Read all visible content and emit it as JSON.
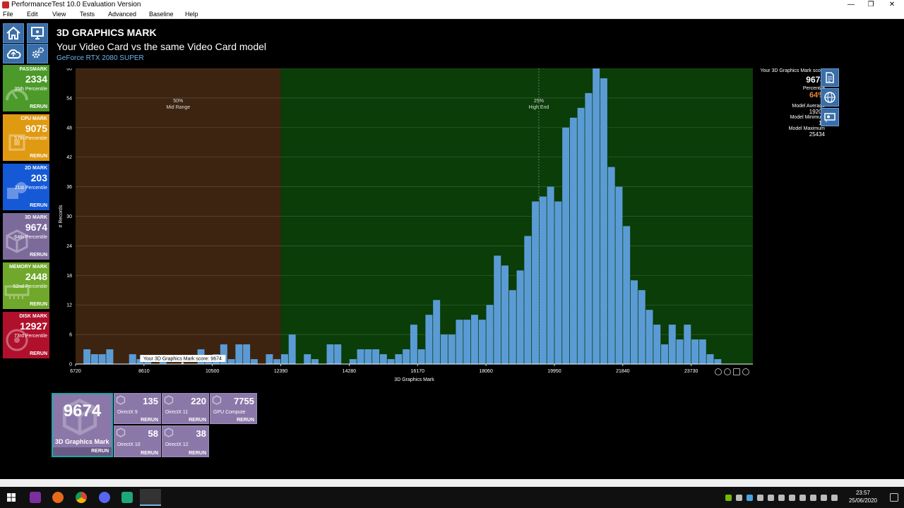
{
  "window": {
    "title": "PerformanceTest 10.0 Evaluation Version"
  },
  "menu": [
    "File",
    "Edit",
    "View",
    "Tests",
    "Advanced",
    "Baseline",
    "Help"
  ],
  "tiles": [
    {
      "name": "PASSMARK",
      "value": "2334",
      "percentile": "35th Percentile",
      "rerun": "RERUN",
      "color": "#4c9a2a"
    },
    {
      "name": "CPU MARK",
      "value": "9075",
      "percentile": "57th Percentile",
      "rerun": "RERUN",
      "color": "#e09a12"
    },
    {
      "name": "2D MARK",
      "value": "203",
      "percentile": "21st Percentile",
      "rerun": "RERUN",
      "color": "#1559d6"
    },
    {
      "name": "3D MARK",
      "value": "9674",
      "percentile": "64th Percentile",
      "rerun": "RERUN",
      "color": "#7c6a9a"
    },
    {
      "name": "MEMORY MARK",
      "value": "2448",
      "percentile": "52nd Percentile",
      "rerun": "RERUN",
      "color": "#6fa82a"
    },
    {
      "name": "DISK MARK",
      "value": "12927",
      "percentile": "73rd Percentile",
      "rerun": "RERUN",
      "color": "#b0102c"
    }
  ],
  "heading": "3D GRAPHICS MARK",
  "subheading": "Your Video Card vs the same Video Card model",
  "gpu_name": "GeForce RTX 2080 SUPER",
  "score_panel": {
    "label": "Your 3D Graphics Mark score",
    "score": "9674",
    "percentile_label": "Percentile",
    "percentile": "64%",
    "avg_label": "Model Average",
    "avg": "19206",
    "min_label": "Model Minimum",
    "min": "10",
    "max_label": "Model Maximum",
    "max": "25434"
  },
  "chart_data": {
    "type": "bar",
    "xlabel": "3D Graphics Mark",
    "ylabel": "# Records",
    "xlim": [
      6720,
      25434
    ],
    "ylim": [
      0,
      60
    ],
    "x_ticks": [
      6720,
      8610,
      10500,
      12390,
      14280,
      16170,
      18060,
      19950,
      21840,
      23730
    ],
    "y_ticks": [
      0,
      6,
      12,
      18,
      24,
      30,
      36,
      42,
      48,
      54,
      60
    ],
    "grid": true,
    "regions": [
      {
        "pct": "50%",
        "label": "Mid Range",
        "from": 6720,
        "to": 12390,
        "color": "#3d2410"
      },
      {
        "pct": "25%",
        "label": "High End",
        "from": 12390,
        "to": 25434,
        "color": "#0a3d08"
      }
    ],
    "bin_start": 6720,
    "bin_width": 210,
    "values": [
      0,
      3,
      2,
      2,
      3,
      0,
      0,
      2,
      1,
      1,
      0,
      1,
      0,
      0,
      0,
      0,
      3,
      1,
      2,
      4,
      1,
      4,
      4,
      1,
      0,
      2,
      1,
      2,
      6,
      0,
      2,
      1,
      0,
      4,
      4,
      0,
      1,
      3,
      3,
      3,
      2,
      1,
      2,
      3,
      8,
      3,
      10,
      13,
      6,
      6,
      9,
      9,
      10,
      9,
      12,
      22,
      20,
      15,
      19,
      26,
      33,
      34,
      36,
      33,
      48,
      50,
      52,
      55,
      60,
      58,
      40,
      36,
      28,
      17,
      15,
      11,
      8,
      4,
      8,
      5,
      8,
      5,
      5,
      2,
      1
    ],
    "bar_color": "#5b9bd5",
    "marker_label": "Your 3D Graphics Mark score: 9674",
    "marker_value": 9674,
    "median_value": 19520
  },
  "sub_tiles": {
    "main": {
      "value": "9674",
      "name": "3D Graphics Mark",
      "rerun": "RERUN"
    },
    "dx9": {
      "value": "135",
      "name": "DirectX 9",
      "rerun": "RERUN"
    },
    "dx11": {
      "value": "220",
      "name": "DirectX 11",
      "rerun": "RERUN"
    },
    "gpu": {
      "value": "7755",
      "name": "GPU Compute",
      "rerun": "RERUN"
    },
    "dx10": {
      "value": "58",
      "name": "DirectX 10",
      "rerun": "RERUN"
    },
    "dx12": {
      "value": "38",
      "name": "DirectX 12",
      "rerun": "RERUN"
    }
  },
  "taskbar": {
    "time": "23:57",
    "date": "25/06/2020"
  }
}
